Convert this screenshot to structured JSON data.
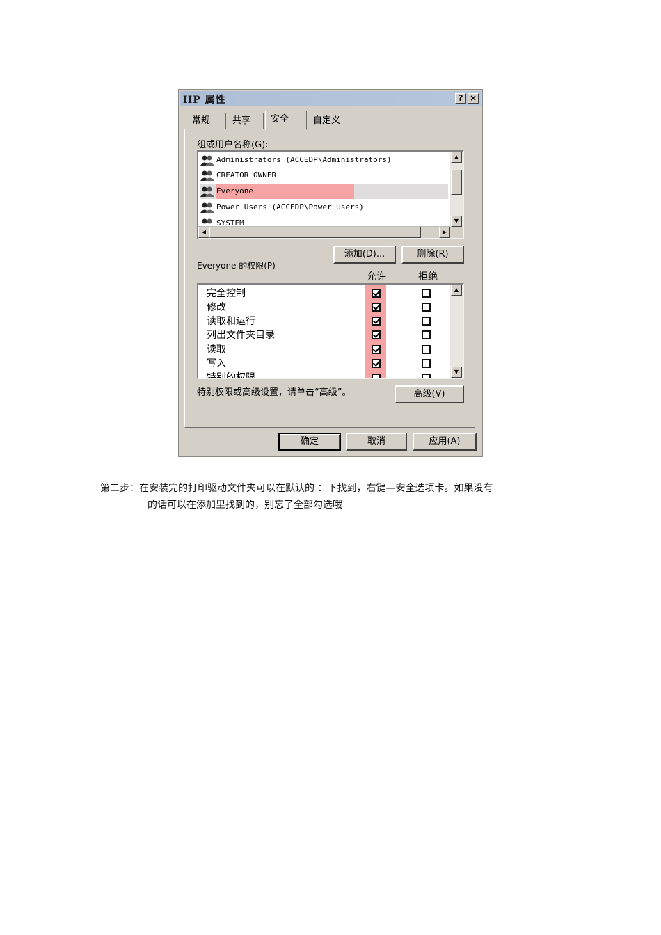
{
  "dialog": {
    "title": "HP 属性",
    "help_button": "?",
    "close_button": "×",
    "tabs": [
      "常规",
      "共享",
      "安全",
      "自定义"
    ],
    "active_tab": "安全",
    "users_label": "组或用户名称(G):",
    "users": [
      {
        "name": "Administrators (ACCEDP\\Administrators)",
        "icon": "user-group-icon"
      },
      {
        "name": "CREATOR OWNER",
        "icon": "user-group-icon"
      },
      {
        "name": "Everyone",
        "icon": "user-group-icon",
        "selected": true
      },
      {
        "name": "Power Users (ACCEDP\\Power Users)",
        "icon": "user-group-icon"
      },
      {
        "name": "SYSTEM",
        "icon": "user-group-icon"
      }
    ],
    "add_button": "添加(D)...",
    "remove_button": "删除(R)",
    "permissions_label": "Everyone 的权限(P)",
    "allow_header": "允许",
    "deny_header": "拒绝",
    "permissions": [
      {
        "name": "完全控制",
        "allow": true,
        "deny": false
      },
      {
        "name": "修改",
        "allow": true,
        "deny": false
      },
      {
        "name": "读取和运行",
        "allow": true,
        "deny": false
      },
      {
        "name": "列出文件夹目录",
        "allow": true,
        "deny": false
      },
      {
        "name": "读取",
        "allow": true,
        "deny": false
      },
      {
        "name": "写入",
        "allow": true,
        "deny": false
      },
      {
        "name": "特别的权限",
        "allow": false,
        "deny": false
      }
    ],
    "advanced_hint": "特别权限或高级设置，请单击“高级”。",
    "advanced_button": "高级(V)",
    "ok_button": "确定",
    "cancel_button": "取消",
    "apply_button": "应用(A)",
    "highlight_color": "#f5a3a3"
  },
  "caption": {
    "line1": "第二步：在安装完的打印驱动文件夹可以在默认的  ：下找到，右键—安全选项卡。如果没有",
    "line2": "的话可以在添加里找到的，别忘了全部勾选哦"
  }
}
